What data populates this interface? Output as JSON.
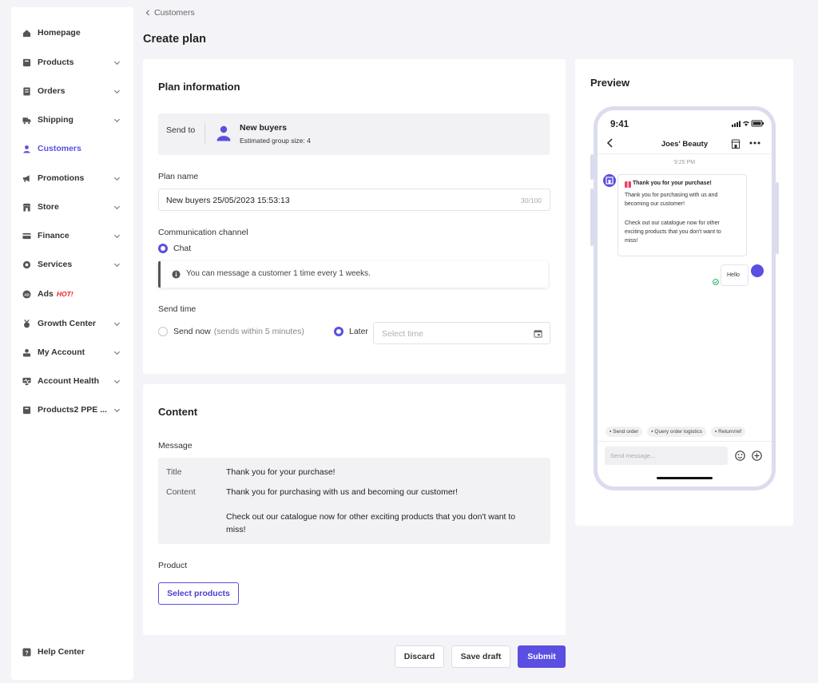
{
  "sidebar": {
    "items": [
      {
        "label": "Homepage",
        "icon": "home-icon",
        "has_chevron": false
      },
      {
        "label": "Products",
        "icon": "products-icon",
        "has_chevron": true
      },
      {
        "label": "Orders",
        "icon": "orders-icon",
        "has_chevron": true
      },
      {
        "label": "Shipping",
        "icon": "shipping-icon",
        "has_chevron": true
      },
      {
        "label": "Customers",
        "icon": "customers-icon",
        "has_chevron": false,
        "active": true
      },
      {
        "label": "Promotions",
        "icon": "promotions-icon",
        "has_chevron": true
      },
      {
        "label": "Store",
        "icon": "store-icon",
        "has_chevron": true
      },
      {
        "label": "Finance",
        "icon": "finance-icon",
        "has_chevron": true
      },
      {
        "label": "Services",
        "icon": "services-icon",
        "has_chevron": true
      },
      {
        "label": "Ads",
        "icon": "ads-icon",
        "has_chevron": false,
        "badge": "HOT!"
      },
      {
        "label": "Growth Center",
        "icon": "growth-icon",
        "has_chevron": true
      },
      {
        "label": "My Account",
        "icon": "account-icon",
        "has_chevron": true
      },
      {
        "label": "Account Health",
        "icon": "health-icon",
        "has_chevron": true
      },
      {
        "label": "Products2 PPE ...",
        "icon": "products2-icon",
        "has_chevron": true
      }
    ],
    "help": {
      "label": "Help Center",
      "icon": "help-icon"
    }
  },
  "breadcrumb": {
    "label": "Customers"
  },
  "page": {
    "title": "Create plan"
  },
  "plan_info": {
    "title": "Plan information",
    "send_to_label": "Send to",
    "group_name": "New buyers",
    "group_size": "Estimated group size: 4",
    "plan_name_label": "Plan name",
    "plan_name_value": "New buyers 25/05/2023 15:53:13",
    "plan_name_count": "30/100",
    "channel_label": "Communication channel",
    "channel_option": "Chat",
    "notice": "You can message a customer 1 time every 1 weeks.",
    "send_time_label": "Send time",
    "send_now_label": "Send now",
    "send_now_hint": "(sends within 5 minutes)",
    "later_label": "Later",
    "time_placeholder": "Select time"
  },
  "content": {
    "title": "Content",
    "message_label": "Message",
    "msg_title_key": "Title",
    "msg_title_value": "Thank you for your purchase!",
    "msg_content_key": "Content",
    "msg_content_line1": "Thank you for purchasing with us and becoming our customer!",
    "msg_content_line2": "Check out our catalogue now for other exciting products that you don't want to",
    "msg_content_line3": "miss!",
    "product_label": "Product",
    "select_products": "Select products"
  },
  "actions": {
    "discard": "Discard",
    "save_draft": "Save draft",
    "submit": "Submit"
  },
  "preview": {
    "title": "Preview",
    "time": "9:41",
    "shop_name": "Joes' Beauty",
    "timestamp": "9:25 PM",
    "bubble_title": "Thank you for your purchase!",
    "bubble_line1": "Thank you for purchasing with us and",
    "bubble_line2": "becoming our customer!",
    "bubble_line3": "Check out our catalogue now for other",
    "bubble_line4": "exciting products that you don't want to",
    "bubble_line5": "miss!",
    "reply": "Hello",
    "quick_replies": [
      "Send order",
      "Query order logistics",
      "Return/ref"
    ],
    "input_placeholder": "Send message..."
  },
  "colors": {
    "accent": "#5a4fe0",
    "hot": "#e8242d",
    "background": "#f4f4f8"
  }
}
